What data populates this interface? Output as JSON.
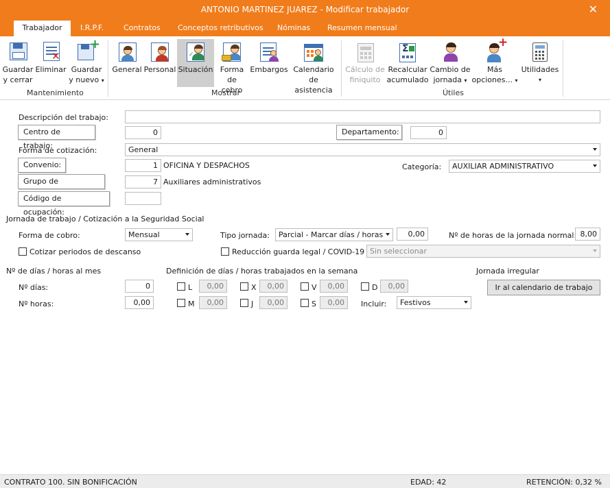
{
  "window": {
    "title": "ANTONIO MARTINEZ JUAREZ - Modificar trabajador",
    "close_icon": "close-icon"
  },
  "tabs": [
    {
      "label": "Trabajador",
      "active": true
    },
    {
      "label": "I.R.P.F."
    },
    {
      "label": "Contratos"
    },
    {
      "label": "Conceptos retributivos"
    },
    {
      "label": "Nóminas"
    },
    {
      "label": "Resumen mensual"
    }
  ],
  "ribbon": {
    "groups": {
      "mantenimiento": "Mantenimiento",
      "mostrar": "Mostrar",
      "utiles": "Útiles"
    },
    "buttons": {
      "guardar_cerrar": {
        "line1": "Guardar",
        "line2": "y cerrar"
      },
      "eliminar": {
        "line1": "Eliminar"
      },
      "guardar_nuevo": {
        "line1": "Guardar",
        "line2": "y nuevo"
      },
      "general": {
        "line1": "General"
      },
      "personal": {
        "line1": "Personal"
      },
      "situacion": {
        "line1": "Situación"
      },
      "forma_cobro": {
        "line1": "Forma",
        "line2": "de cobro"
      },
      "embargos": {
        "line1": "Embargos"
      },
      "calendario": {
        "line1": "Calendario",
        "line2": "de asistencia"
      },
      "calculo_finiquito": {
        "line1": "Cálculo de",
        "line2": "finiquito"
      },
      "recalcular": {
        "line1": "Recalcular",
        "line2": "acumulado"
      },
      "cambio_jornada": {
        "line1": "Cambio de",
        "line2": "jornada"
      },
      "mas_opciones": {
        "line1": "Más",
        "line2": "opciones..."
      },
      "utilidades": {
        "line1": "Utilidades"
      }
    }
  },
  "form": {
    "descripcion_label": "Descripción del trabajo:",
    "descripcion_value": "",
    "centro_label": "Centro de trabajo:",
    "centro_value": "0",
    "departamento_label": "Departamento:",
    "departamento_value": "0",
    "forma_cotizacion_label": "Forma de cotización:",
    "forma_cotizacion_value": "General",
    "convenio_label": "Convenio:",
    "convenio_code": "1",
    "convenio_name": "OFICINA Y DESPACHOS",
    "categoria_label": "Categoría:",
    "categoria_value": "AUXILIAR ADMINISTRATIVO",
    "grupo_label": "Grupo de cotización:",
    "grupo_code": "7",
    "grupo_name": "Auxiliares administrativos",
    "ocupacion_label": "Código de ocupación:",
    "ocupacion_value": ""
  },
  "jornada": {
    "section_title": "Jornada de trabajo / Cotización a la Seguridad Social",
    "forma_cobro_label": "Forma de cobro:",
    "forma_cobro_value": "Mensual",
    "tipo_jornada_label": "Tipo jornada:",
    "tipo_jornada_value": "Parcial - Marcar días / horas",
    "tipo_jornada_pct": "0,00",
    "horas_normal_label": "Nº de horas de la jornada normal:",
    "horas_normal_value": "8,00",
    "cotizar_descanso_label": "Cotizar periodos de descanso",
    "reduccion_label": "Reducción guarda legal / COVID-19",
    "reduccion_select": "Sin seleccionar"
  },
  "dias_mes": {
    "title": "Nº de días / horas al mes",
    "dias_label": "Nº días:",
    "dias_value": "0",
    "horas_label": "Nº horas:",
    "horas_value": "0,00"
  },
  "semana": {
    "title": "Definición de días / horas trabajados en la semana",
    "days": [
      {
        "letter": "L",
        "value": "0,00"
      },
      {
        "letter": "X",
        "value": "0,00"
      },
      {
        "letter": "V",
        "value": "0,00"
      },
      {
        "letter": "D",
        "value": "0,00"
      },
      {
        "letter": "M",
        "value": "0,00"
      },
      {
        "letter": "J",
        "value": "0,00"
      },
      {
        "letter": "S",
        "value": "0,00"
      }
    ],
    "incluir_label": "Incluir:",
    "incluir_value": "Festivos"
  },
  "irregular": {
    "title": "Jornada irregular",
    "button": "Ir al calendario de trabajo"
  },
  "status": {
    "contrato": "CONTRATO 100.  SIN BONIFICACIÓN",
    "edad": "EDAD: 42",
    "retencion": "RETENCIÓN: 0,32 %"
  }
}
